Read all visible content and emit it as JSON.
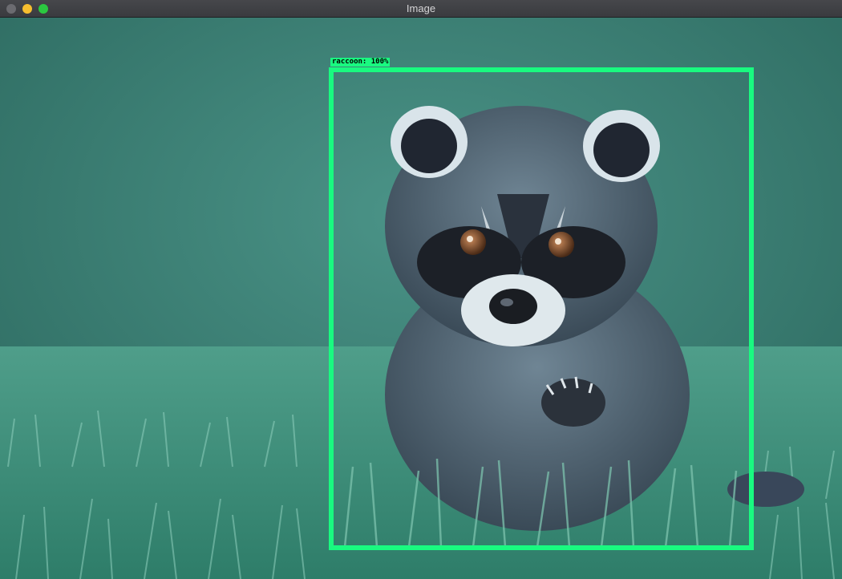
{
  "window": {
    "title": "Image",
    "buttons": [
      "close",
      "minimize",
      "maximize"
    ]
  },
  "detection": {
    "label": "raccoon: 100%",
    "box_color": "#19fa80"
  },
  "colors": {
    "close": "#6b6b70",
    "minimize": "#f6be2f",
    "maximize": "#2bc840",
    "grass": "#3a8a78"
  },
  "image_subject": "raccoon"
}
